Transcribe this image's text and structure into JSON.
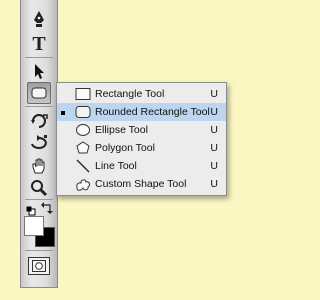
{
  "tool_shape_menu": {
    "items": [
      {
        "label": "Rectangle Tool",
        "shortcut": "U",
        "icon": "rectangle-icon",
        "selected": false
      },
      {
        "label": "Rounded Rectangle Tool",
        "shortcut": "U",
        "icon": "rounded-rectangle-icon",
        "selected": true
      },
      {
        "label": "Ellipse Tool",
        "shortcut": "U",
        "icon": "ellipse-icon",
        "selected": false
      },
      {
        "label": "Polygon Tool",
        "shortcut": "U",
        "icon": "polygon-icon",
        "selected": false
      },
      {
        "label": "Line Tool",
        "shortcut": "U",
        "icon": "line-icon",
        "selected": false
      },
      {
        "label": "Custom Shape Tool",
        "shortcut": "U",
        "icon": "custom-shape-icon",
        "selected": false
      }
    ]
  },
  "toolbar": {
    "type_tool_glyph": "T",
    "tools": [
      "pen-icon",
      "type-icon",
      "path-selection-icon",
      "rounded-rectangle-icon",
      "3d-rotate-icon",
      "3d-orbit-icon",
      "hand-icon",
      "zoom-icon",
      "default-colors-icon",
      "swap-colors-icon",
      "foreground-color-swatch",
      "background-color-swatch",
      "quick-mask-icon"
    ]
  },
  "colors": {
    "background": "#fbf7c3",
    "selection": "#bcd6ef",
    "foreground_color": "#ffffff",
    "background_color": "#000000"
  }
}
